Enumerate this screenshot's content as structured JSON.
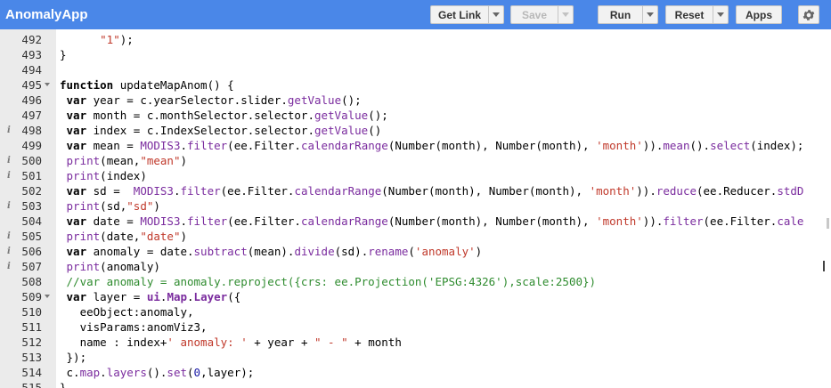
{
  "app": {
    "title": "AnomalyApp"
  },
  "toolbar": {
    "get_link": "Get Link",
    "save": "Save",
    "run": "Run",
    "reset": "Reset",
    "apps": "Apps"
  },
  "editor": {
    "lines": [
      {
        "n": "492",
        "info": false,
        "fold": false,
        "code": [
          {
            "t": "      "
          },
          {
            "t": "\"1\"",
            "c": "str"
          },
          {
            "t": ");"
          }
        ]
      },
      {
        "n": "493",
        "info": false,
        "fold": false,
        "code": [
          {
            "t": "}"
          }
        ]
      },
      {
        "n": "494",
        "info": false,
        "fold": false,
        "code": []
      },
      {
        "n": "495",
        "info": false,
        "fold": true,
        "code": [
          {
            "t": "function",
            "c": "kw"
          },
          {
            "t": " updateMapAnom() {"
          }
        ]
      },
      {
        "n": "496",
        "info": false,
        "fold": false,
        "code": [
          {
            "t": " "
          },
          {
            "t": "var",
            "c": "kw"
          },
          {
            "t": " year = c.yearSelector.slider."
          },
          {
            "t": "getValue",
            "c": "fn"
          },
          {
            "t": "();"
          }
        ]
      },
      {
        "n": "497",
        "info": false,
        "fold": false,
        "code": [
          {
            "t": " "
          },
          {
            "t": "var",
            "c": "kw"
          },
          {
            "t": " month = c.monthSelector.selector."
          },
          {
            "t": "getValue",
            "c": "fn"
          },
          {
            "t": "();"
          }
        ]
      },
      {
        "n": "498",
        "info": true,
        "fold": false,
        "code": [
          {
            "t": " "
          },
          {
            "t": "var",
            "c": "kw"
          },
          {
            "t": " index = c.IndexSelector.selector."
          },
          {
            "t": "getValue",
            "c": "fn"
          },
          {
            "t": "()"
          }
        ]
      },
      {
        "n": "499",
        "info": false,
        "fold": false,
        "code": [
          {
            "t": " "
          },
          {
            "t": "var",
            "c": "kw"
          },
          {
            "t": " mean = "
          },
          {
            "t": "MODIS3",
            "c": "fn"
          },
          {
            "t": "."
          },
          {
            "t": "filter",
            "c": "fn"
          },
          {
            "t": "(ee.Filter."
          },
          {
            "t": "calendarRange",
            "c": "fn"
          },
          {
            "t": "(Number(month), Number(month), "
          },
          {
            "t": "'month'",
            "c": "str"
          },
          {
            "t": "))."
          },
          {
            "t": "mean",
            "c": "fn"
          },
          {
            "t": "()."
          },
          {
            "t": "select",
            "c": "fn"
          },
          {
            "t": "(index);"
          }
        ]
      },
      {
        "n": "500",
        "info": true,
        "fold": false,
        "code": [
          {
            "t": " "
          },
          {
            "t": "print",
            "c": "fn"
          },
          {
            "t": "(mean,"
          },
          {
            "t": "\"mean\"",
            "c": "str"
          },
          {
            "t": ")"
          }
        ]
      },
      {
        "n": "501",
        "info": true,
        "fold": false,
        "code": [
          {
            "t": " "
          },
          {
            "t": "print",
            "c": "fn"
          },
          {
            "t": "(index)"
          }
        ]
      },
      {
        "n": "502",
        "info": false,
        "fold": false,
        "code": [
          {
            "t": " "
          },
          {
            "t": "var",
            "c": "kw"
          },
          {
            "t": " sd =  "
          },
          {
            "t": "MODIS3",
            "c": "fn"
          },
          {
            "t": "."
          },
          {
            "t": "filter",
            "c": "fn"
          },
          {
            "t": "(ee.Filter."
          },
          {
            "t": "calendarRange",
            "c": "fn"
          },
          {
            "t": "(Number(month), Number(month), "
          },
          {
            "t": "'month'",
            "c": "str"
          },
          {
            "t": "))."
          },
          {
            "t": "reduce",
            "c": "fn"
          },
          {
            "t": "(ee.Reducer."
          },
          {
            "t": "stdD",
            "c": "fn"
          }
        ]
      },
      {
        "n": "503",
        "info": true,
        "fold": false,
        "code": [
          {
            "t": " "
          },
          {
            "t": "print",
            "c": "fn"
          },
          {
            "t": "(sd,"
          },
          {
            "t": "\"sd\"",
            "c": "str"
          },
          {
            "t": ")"
          }
        ]
      },
      {
        "n": "504",
        "info": false,
        "fold": false,
        "code": [
          {
            "t": " "
          },
          {
            "t": "var",
            "c": "kw"
          },
          {
            "t": " date = "
          },
          {
            "t": "MODIS3",
            "c": "fn"
          },
          {
            "t": "."
          },
          {
            "t": "filter",
            "c": "fn"
          },
          {
            "t": "(ee.Filter."
          },
          {
            "t": "calendarRange",
            "c": "fn"
          },
          {
            "t": "(Number(month), Number(month), "
          },
          {
            "t": "'month'",
            "c": "str"
          },
          {
            "t": "))."
          },
          {
            "t": "filter",
            "c": "fn"
          },
          {
            "t": "(ee.Filter."
          },
          {
            "t": "cale",
            "c": "fn"
          }
        ]
      },
      {
        "n": "505",
        "info": true,
        "fold": false,
        "code": [
          {
            "t": " "
          },
          {
            "t": "print",
            "c": "fn"
          },
          {
            "t": "(date,"
          },
          {
            "t": "\"date\"",
            "c": "str"
          },
          {
            "t": ")"
          }
        ]
      },
      {
        "n": "506",
        "info": true,
        "fold": false,
        "code": [
          {
            "t": " "
          },
          {
            "t": "var",
            "c": "kw"
          },
          {
            "t": " anomaly = date."
          },
          {
            "t": "subtract",
            "c": "fn"
          },
          {
            "t": "(mean)."
          },
          {
            "t": "divide",
            "c": "fn"
          },
          {
            "t": "(sd)."
          },
          {
            "t": "rename",
            "c": "fn"
          },
          {
            "t": "("
          },
          {
            "t": "'anomaly'",
            "c": "str"
          },
          {
            "t": ")"
          }
        ]
      },
      {
        "n": "507",
        "info": true,
        "fold": false,
        "code": [
          {
            "t": " "
          },
          {
            "t": "print",
            "c": "fn"
          },
          {
            "t": "(anomaly)"
          }
        ]
      },
      {
        "n": "508",
        "info": false,
        "fold": false,
        "code": [
          {
            "t": " "
          },
          {
            "t": "//var anomaly = anomaly.reproject({crs: ee.Projection('EPSG:4326'),scale:2500})",
            "c": "cm"
          }
        ]
      },
      {
        "n": "509",
        "info": false,
        "fold": true,
        "code": [
          {
            "t": " "
          },
          {
            "t": "var",
            "c": "kw"
          },
          {
            "t": " layer = "
          },
          {
            "t": "ui",
            "c": "gl"
          },
          {
            "t": "."
          },
          {
            "t": "Map",
            "c": "gl"
          },
          {
            "t": "."
          },
          {
            "t": "Layer",
            "c": "gl"
          },
          {
            "t": "({"
          }
        ]
      },
      {
        "n": "510",
        "info": false,
        "fold": false,
        "code": [
          {
            "t": "   eeObject:anomaly,"
          }
        ]
      },
      {
        "n": "511",
        "info": false,
        "fold": false,
        "code": [
          {
            "t": "   visParams:anomViz3,"
          }
        ]
      },
      {
        "n": "512",
        "info": false,
        "fold": false,
        "code": [
          {
            "t": "   name : index+"
          },
          {
            "t": "' anomaly: '",
            "c": "str"
          },
          {
            "t": " + year + "
          },
          {
            "t": "\" - \"",
            "c": "str"
          },
          {
            "t": " + month"
          }
        ]
      },
      {
        "n": "513",
        "info": false,
        "fold": false,
        "code": [
          {
            "t": " });"
          }
        ]
      },
      {
        "n": "514",
        "info": false,
        "fold": false,
        "code": [
          {
            "t": " c."
          },
          {
            "t": "map",
            "c": "fn"
          },
          {
            "t": "."
          },
          {
            "t": "layers",
            "c": "fn"
          },
          {
            "t": "()."
          },
          {
            "t": "set",
            "c": "fn"
          },
          {
            "t": "("
          },
          {
            "t": "0",
            "c": "num"
          },
          {
            "t": ",layer);"
          }
        ]
      },
      {
        "n": "515",
        "info": false,
        "fold": false,
        "code": [
          {
            "t": "}"
          }
        ]
      }
    ]
  }
}
